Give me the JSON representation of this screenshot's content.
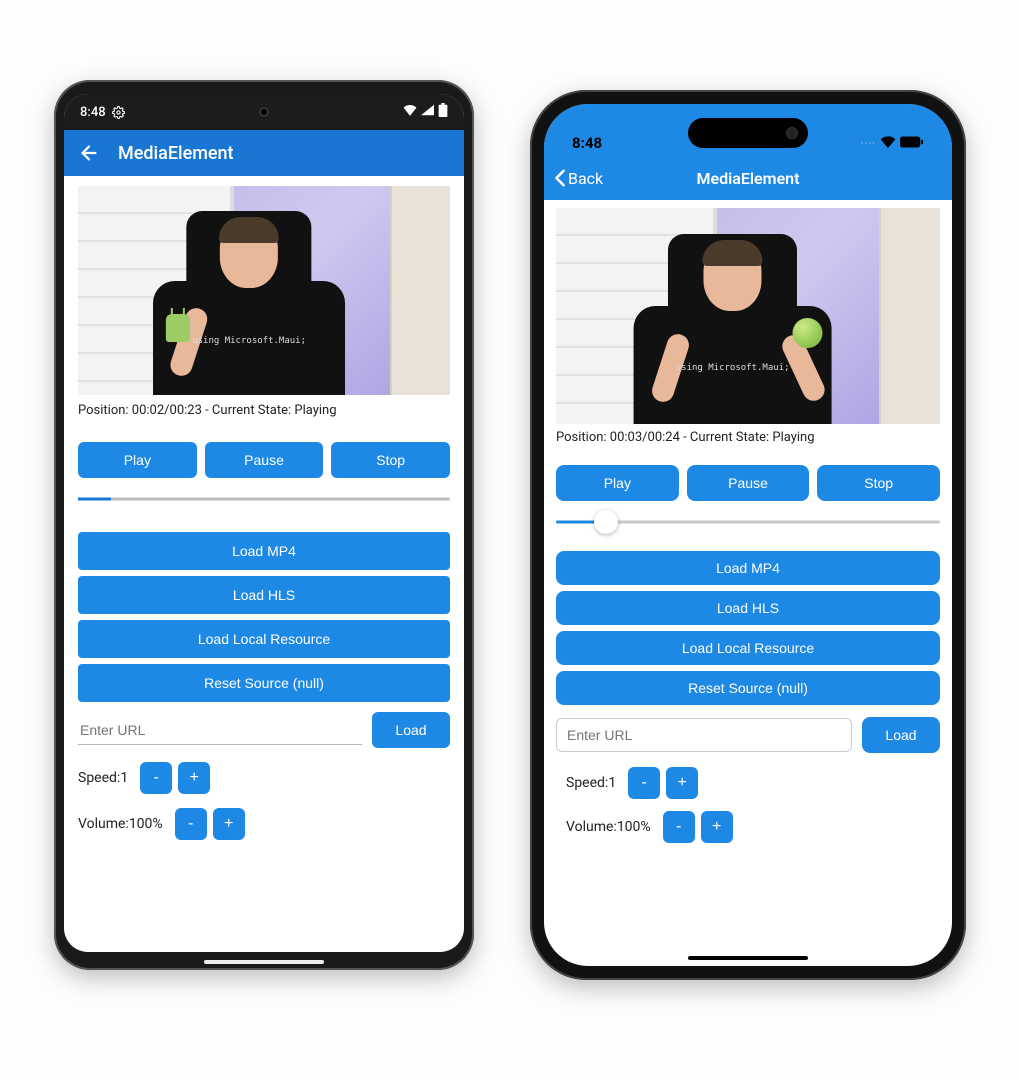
{
  "android": {
    "status": {
      "time": "8:48"
    },
    "appbar": {
      "title": "MediaElement"
    },
    "shirt_text": "using Microsoft.Maui;",
    "position_line": "Position: 00:02/00:23 - Current State: Playing",
    "buttons": {
      "play": "Play",
      "pause": "Pause",
      "stop": "Stop"
    },
    "loads": {
      "mp4": "Load MP4",
      "hls": "Load HLS",
      "local": "Load Local Resource",
      "reset": "Reset Source (null)"
    },
    "url": {
      "placeholder": "Enter URL",
      "load": "Load"
    },
    "speed": {
      "label": "Speed:",
      "value": "1"
    },
    "volume": {
      "label": "Volume:",
      "value": "100%"
    }
  },
  "ios": {
    "status": {
      "time": "8:48"
    },
    "nav": {
      "back": "Back",
      "title": "MediaElement"
    },
    "shirt_text": "using Microsoft.Maui;",
    "position_line": "Position: 00:03/00:24 - Current State: Playing",
    "buttons": {
      "play": "Play",
      "pause": "Pause",
      "stop": "Stop"
    },
    "loads": {
      "mp4": "Load MP4",
      "hls": "Load HLS",
      "local": "Load Local Resource",
      "reset": "Reset Source (null)"
    },
    "url": {
      "placeholder": "Enter URL",
      "load": "Load"
    },
    "speed": {
      "label": "Speed:",
      "value": "1"
    },
    "volume": {
      "label": "Volume:",
      "value": "100%"
    }
  },
  "stepper": {
    "minus": "-",
    "plus": "+"
  }
}
